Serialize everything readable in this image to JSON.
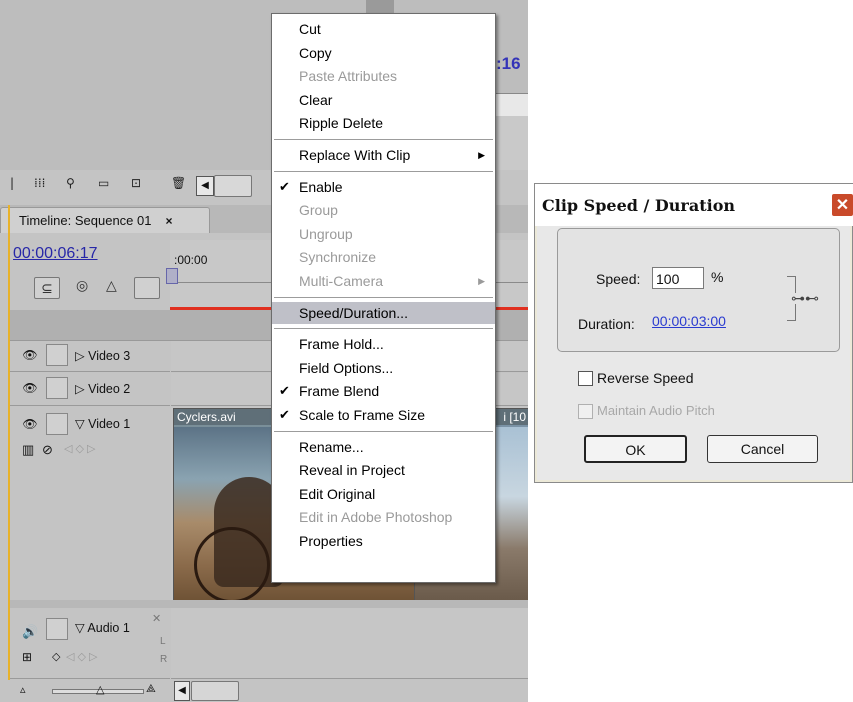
{
  "premiere": {
    "monitor_timecode": ":16",
    "timeline_tab_label": "Timeline: Sequence 01",
    "timeline_tab_close": "×",
    "current_timecode": "00:00:06:17",
    "ruler_start": ":00:00",
    "tracks": [
      {
        "label": "Video 3"
      },
      {
        "label": "Video 2"
      },
      {
        "label": "Video 1"
      },
      {
        "label": "Audio 1"
      }
    ],
    "clip_name": "Cyclers.avi",
    "clip2_name": "i [10",
    "audio_lr": [
      "L",
      "R"
    ]
  },
  "context_menu": {
    "items": [
      {
        "label": "Cut",
        "disabled": false
      },
      {
        "label": "Copy",
        "disabled": false
      },
      {
        "label": "Paste Attributes",
        "disabled": true
      },
      {
        "label": "Clear",
        "disabled": false
      },
      {
        "label": "Ripple Delete",
        "disabled": false
      },
      {
        "label": "Replace With Clip",
        "disabled": false,
        "submenu": true
      },
      {
        "label": "Enable",
        "disabled": false,
        "checked": true
      },
      {
        "label": "Group",
        "disabled": true
      },
      {
        "label": "Ungroup",
        "disabled": true
      },
      {
        "label": "Synchronize",
        "disabled": true
      },
      {
        "label": "Multi-Camera",
        "disabled": true,
        "submenu": true
      },
      {
        "label": "Speed/Duration...",
        "disabled": false,
        "highlighted": true
      },
      {
        "label": "Frame Hold...",
        "disabled": false
      },
      {
        "label": "Field Options...",
        "disabled": false
      },
      {
        "label": "Frame Blend",
        "disabled": false,
        "checked": true
      },
      {
        "label": "Scale to Frame Size",
        "disabled": false,
        "checked": true
      },
      {
        "label": "Rename...",
        "disabled": false
      },
      {
        "label": "Reveal in Project",
        "disabled": false
      },
      {
        "label": "Edit Original",
        "disabled": false
      },
      {
        "label": "Edit in Adobe Photoshop",
        "disabled": true
      },
      {
        "label": "Properties",
        "disabled": false
      }
    ],
    "checkmark": "✔",
    "submenu_arrow": "▶"
  },
  "dialog": {
    "title": "Clip Speed / Duration",
    "close_label": "✕",
    "speed_label": "Speed:",
    "speed_value": "100",
    "percent": "%",
    "duration_label": "Duration:",
    "duration_value": "00:00:03:00",
    "link_icon": "link-icon",
    "reverse_speed_label": "Reverse Speed",
    "reverse_speed_checked": false,
    "maintain_pitch_label": "Maintain Audio Pitch",
    "maintain_pitch_enabled": false,
    "ok_label": "OK",
    "cancel_label": "Cancel"
  }
}
